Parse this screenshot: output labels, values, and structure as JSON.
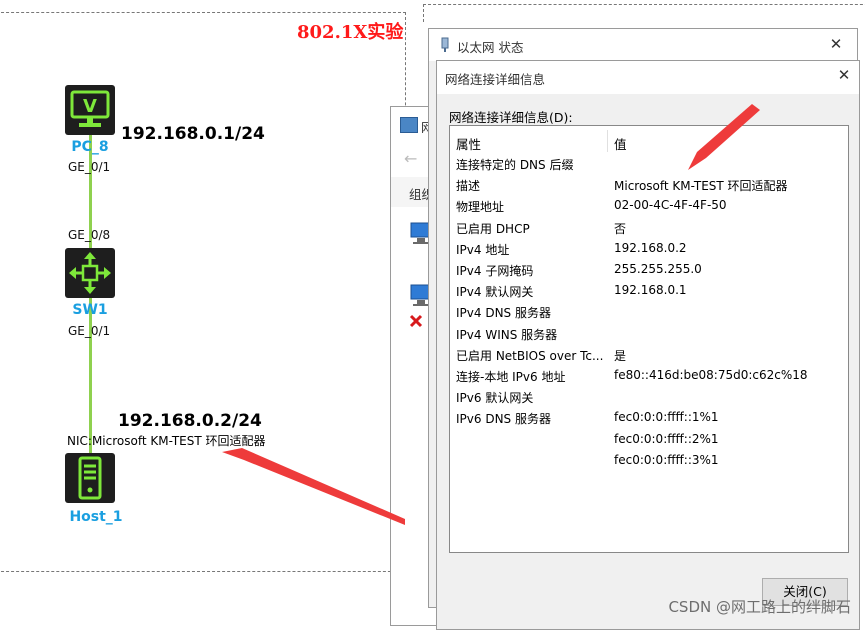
{
  "topology": {
    "title": "802.1X实验",
    "devices": {
      "pc": {
        "name": "PC_8",
        "port": "GE_0/1",
        "ip": "192.168.0.1/24"
      },
      "switch": {
        "name": "SW1",
        "port_top": "GE_0/8",
        "port_bottom": "GE_0/1"
      },
      "host": {
        "name": "Host_1",
        "ip": "192.168.0.2/24",
        "nic": "NIC:Microsoft KM-TEST 环回适配器"
      }
    },
    "link_color": "#8fd14f"
  },
  "status_window": {
    "title": "以太网 状态"
  },
  "behind_window": {
    "title_fragment": "网",
    "toolbar_fragment": "组织"
  },
  "details_dialog": {
    "title": "网络连接详细信息",
    "list_label": "网络连接详细信息(D):",
    "columns": [
      "属性",
      "值"
    ],
    "rows": [
      {
        "prop": "连接特定的 DNS 后缀",
        "value": ""
      },
      {
        "prop": "描述",
        "value": "Microsoft KM-TEST 环回适配器"
      },
      {
        "prop": "物理地址",
        "value": "02-00-4C-4F-4F-50"
      },
      {
        "prop": "已启用 DHCP",
        "value": "否"
      },
      {
        "prop": "IPv4 地址",
        "value": "192.168.0.2"
      },
      {
        "prop": "IPv4 子网掩码",
        "value": "255.255.255.0"
      },
      {
        "prop": "IPv4 默认网关",
        "value": "192.168.0.1"
      },
      {
        "prop": "IPv4 DNS 服务器",
        "value": ""
      },
      {
        "prop": "IPv4 WINS 服务器",
        "value": ""
      },
      {
        "prop": "已启用 NetBIOS over Tc...",
        "value": "是"
      },
      {
        "prop": "连接-本地 IPv6 地址",
        "value": "fe80::416d:be08:75d0:c62c%18"
      },
      {
        "prop": "IPv6 默认网关",
        "value": ""
      },
      {
        "prop": "IPv6 DNS 服务器",
        "value": "fec0:0:0:ffff::1%1"
      },
      {
        "prop": "",
        "value": "fec0:0:0:ffff::2%1"
      },
      {
        "prop": "",
        "value": "fec0:0:0:ffff::3%1"
      }
    ],
    "close_label": "关闭(C)"
  },
  "watermark": "CSDN @网工路上的绊脚石",
  "colors": {
    "accent_red": "#ff1a1a",
    "device_label": "#1a9fe0",
    "device_green": "#7ee83a"
  },
  "icons": [
    "monitor-icon",
    "switch-arrows-icon",
    "server-tower-icon",
    "network-adapter-icon",
    "error-x-icon",
    "close-icon",
    "back-arrow-icon"
  ]
}
